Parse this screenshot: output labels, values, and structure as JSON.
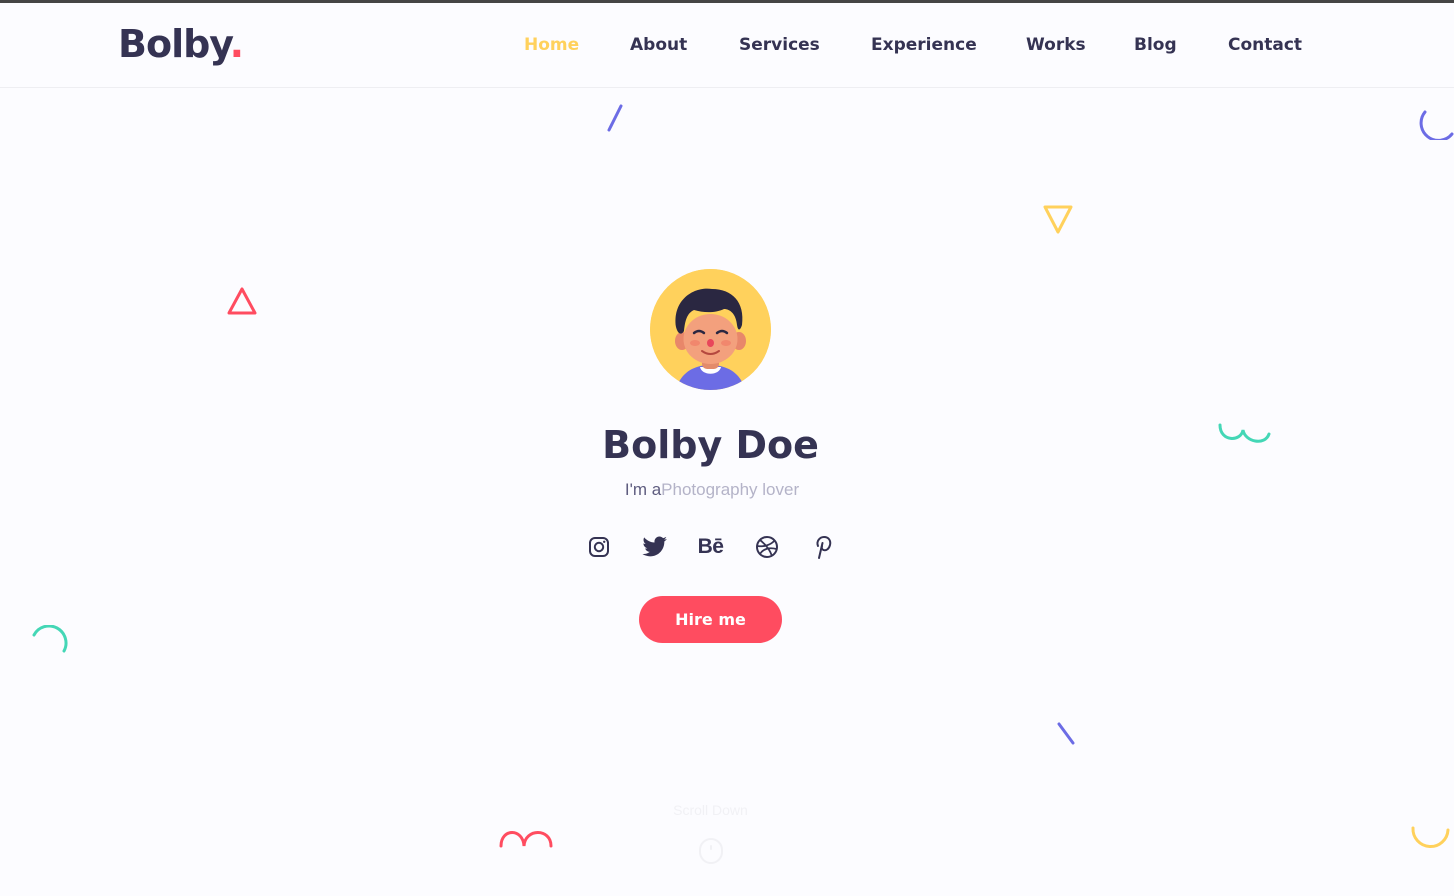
{
  "brand": {
    "name": "Bolby",
    "dot": "."
  },
  "nav": {
    "items": [
      {
        "label": "Home",
        "active": true
      },
      {
        "label": "About"
      },
      {
        "label": "Services"
      },
      {
        "label": "Experience"
      },
      {
        "label": "Works"
      },
      {
        "label": "Blog"
      },
      {
        "label": "Contact"
      }
    ]
  },
  "hero": {
    "name": "Bolby Doe",
    "tagline_prefix": "I'm a",
    "tagline_typed": "Photography lover",
    "hire_label": "Hire me",
    "scroll_label": "Scroll Down"
  },
  "socials": [
    "instagram-icon",
    "twitter-icon",
    "behance-icon",
    "dribbble-icon",
    "pinterest-icon"
  ],
  "behance_text": "Bē",
  "colors": {
    "accent_yellow": "#ffd15c",
    "accent_red": "#ff4c60",
    "accent_purple": "#6c6ce5",
    "accent_green": "#44d7b6",
    "text_dark": "#353353"
  }
}
